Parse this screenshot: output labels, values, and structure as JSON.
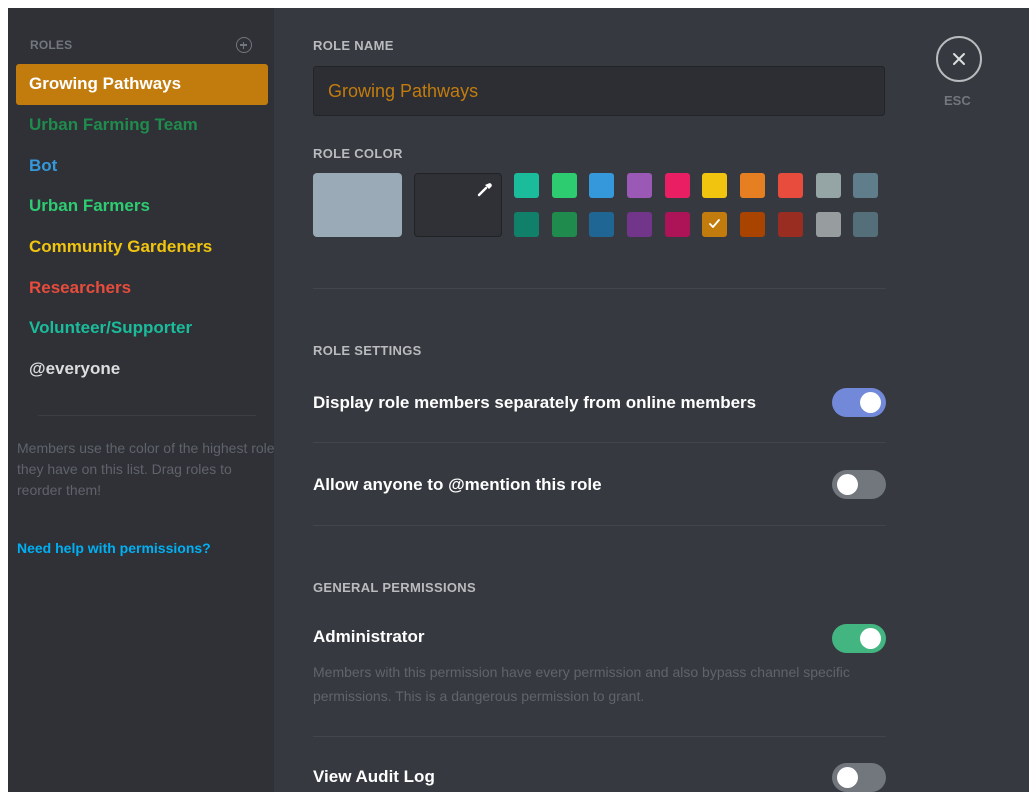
{
  "sidebar": {
    "header": "ROLES",
    "roles": [
      {
        "label": "Growing Pathways",
        "color": "#ffffff",
        "selected": true
      },
      {
        "label": "Urban Farming Team",
        "color": "#1f8b4c"
      },
      {
        "label": "Bot",
        "color": "#3498db"
      },
      {
        "label": "Urban Farmers",
        "color": "#2ecc71"
      },
      {
        "label": "Community Gardeners",
        "color": "#f1c40f"
      },
      {
        "label": "Researchers",
        "color": "#e74c3c"
      },
      {
        "label": "Volunteer/Supporter",
        "color": "#1abc9c"
      },
      {
        "label": "@everyone",
        "color": "#dcddde"
      }
    ],
    "help_text": "Members use the color of the highest role they have on this list. Drag roles to reorder them!",
    "help_link": "Need help with permissions?"
  },
  "role_name": {
    "title": "ROLE NAME",
    "value": "Growing Pathways"
  },
  "role_color": {
    "title": "ROLE COLOR",
    "default_color": "#9aabb7",
    "selected_color": "#c27c0e",
    "swatches": [
      "#1abc9c",
      "#2ecc71",
      "#3498db",
      "#9b59b6",
      "#e91e63",
      "#f1c40f",
      "#e67e22",
      "#e74c3c",
      "#95a5a6",
      "#607d8b",
      "#11806a",
      "#1f8b4c",
      "#206694",
      "#71368a",
      "#ad1457",
      "#c27c0e",
      "#a84300",
      "#992d22",
      "#979c9f",
      "#546e7a"
    ],
    "selected_index": 15
  },
  "role_settings": {
    "title": "ROLE SETTINGS",
    "display_separately": {
      "label": "Display role members separately from online members",
      "on": true,
      "color": "#7289da"
    },
    "allow_mention": {
      "label_prefix": "Allow anyone to ",
      "label_bold": "@mention",
      "label_suffix": " this role",
      "on": false
    }
  },
  "general_permissions": {
    "title": "GENERAL PERMISSIONS",
    "administrator": {
      "label": "Administrator",
      "description": "Members with this permission have every permission and also bypass channel specific permissions. This is a dangerous permission to grant.",
      "on": true,
      "color": "#43b581"
    },
    "view_audit_log": {
      "label": "View Audit Log",
      "on": false
    }
  },
  "close": {
    "label": "ESC",
    "icon": "close-icon"
  }
}
